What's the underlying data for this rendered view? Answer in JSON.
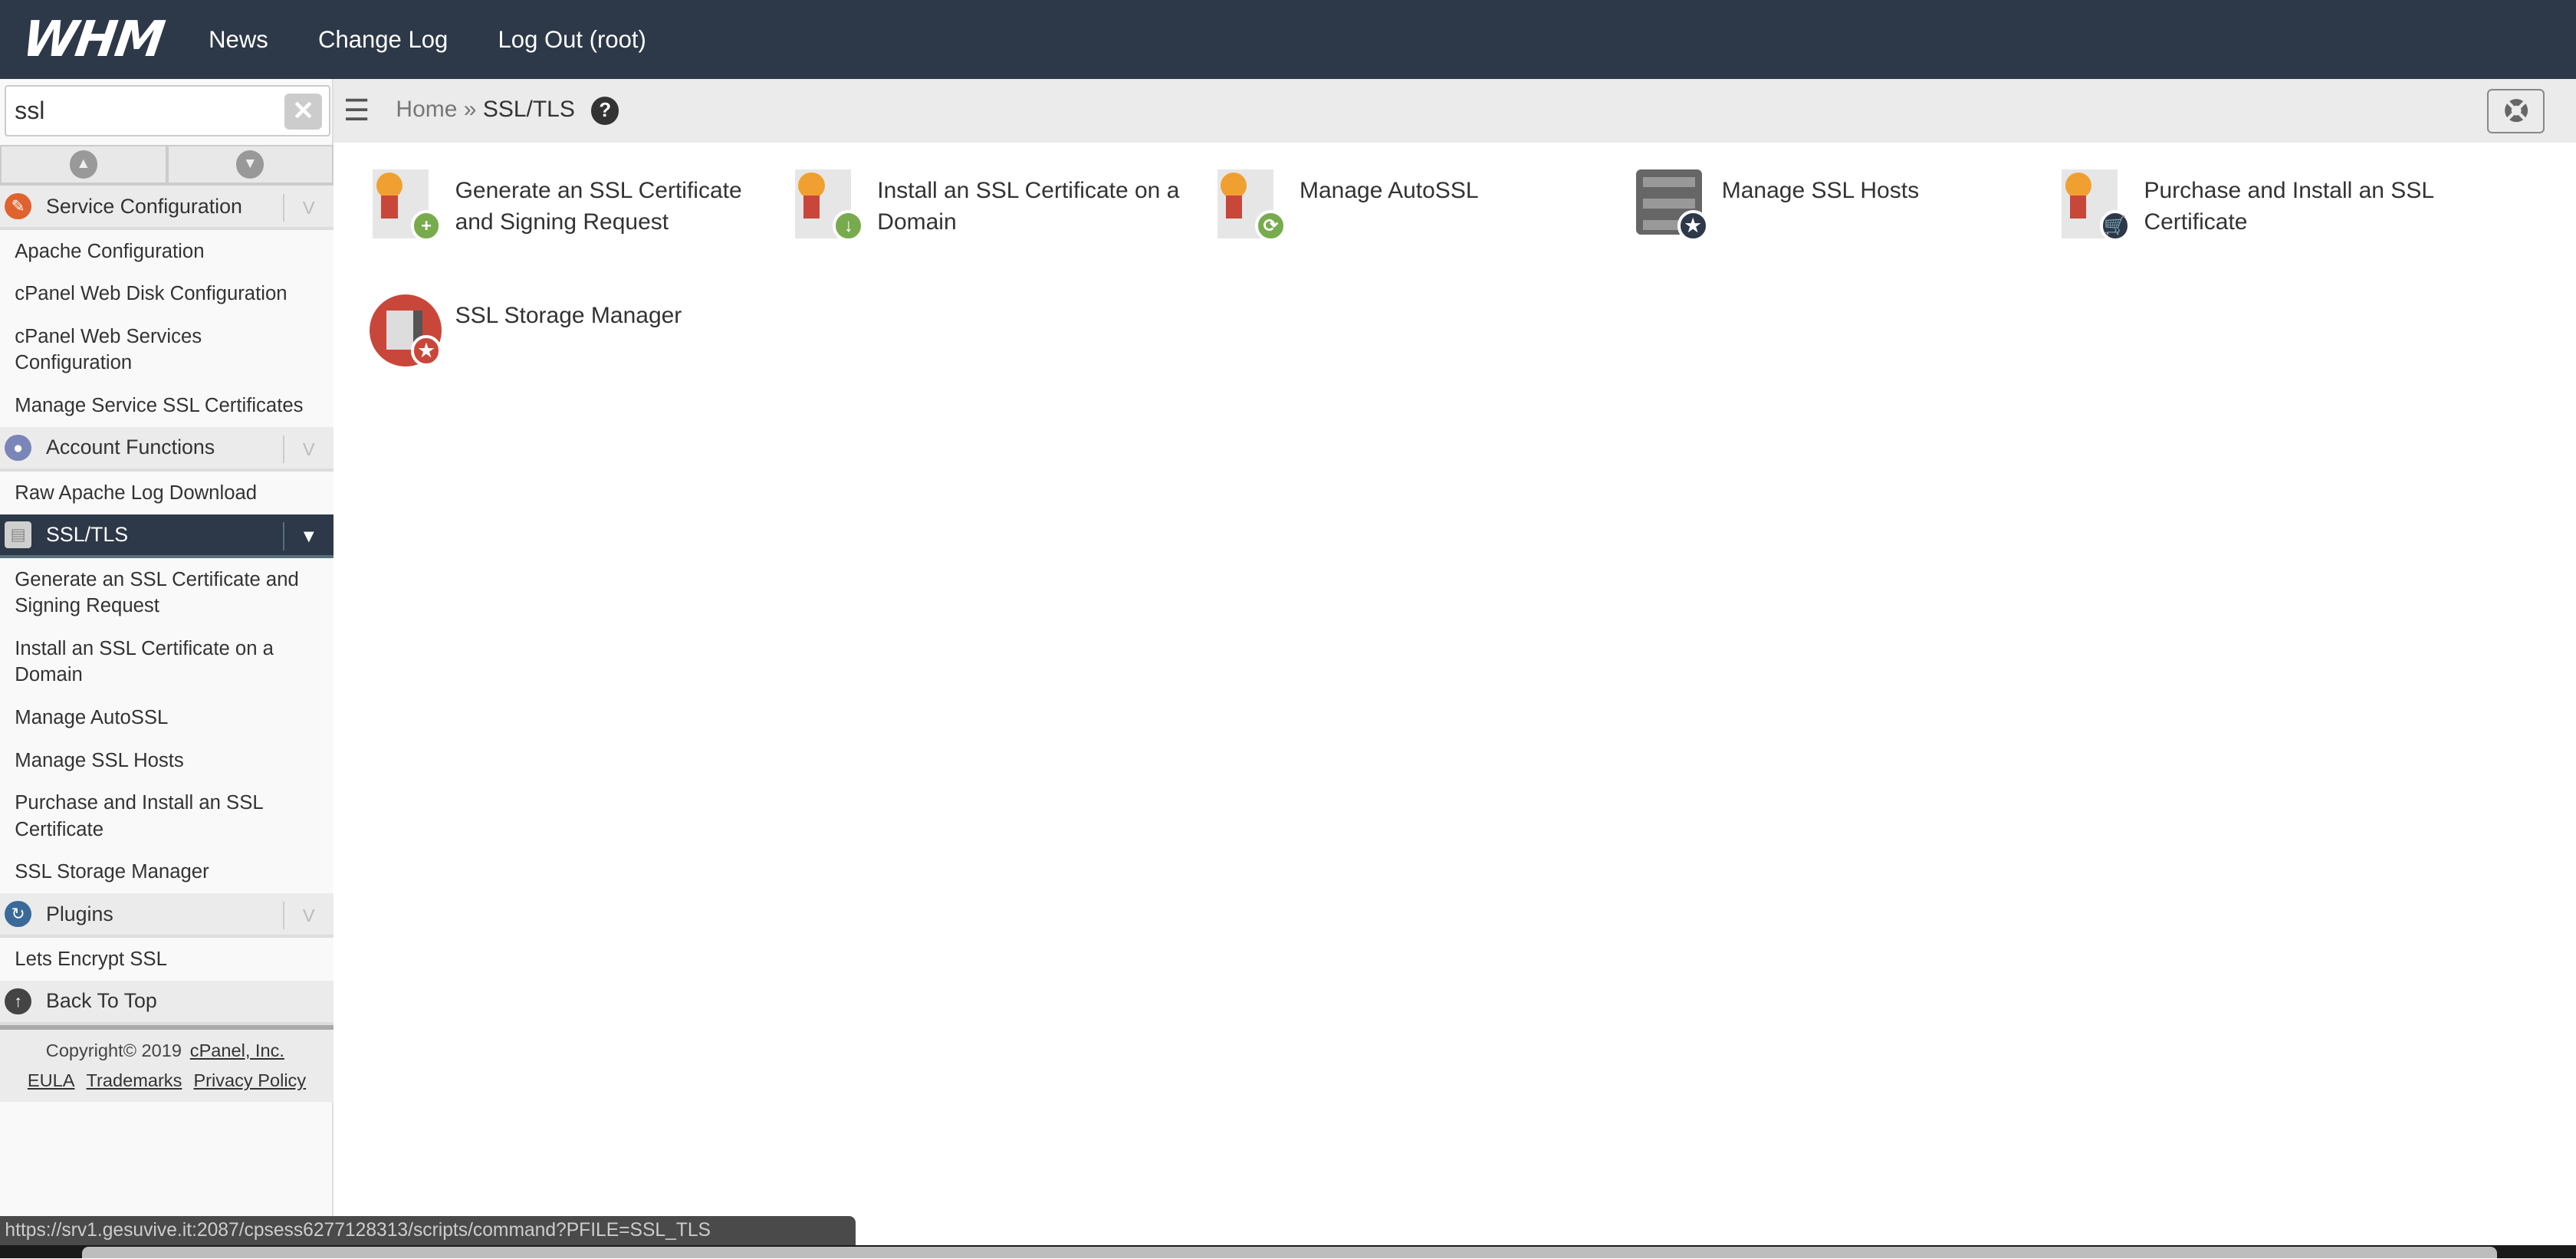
{
  "topbar": {
    "logo": "WHM",
    "nav": [
      "News",
      "Change Log",
      "Log Out (root)"
    ]
  },
  "search": {
    "value": "ssl",
    "clear_icon": "clear-icon"
  },
  "sidebar": {
    "groups": [
      {
        "title": "Service Configuration",
        "icon": "wrench-icon",
        "color": "#e0622f",
        "items": [
          "Apache Configuration",
          "cPanel Web Disk Configuration",
          "cPanel Web Services Configuration",
          "Manage Service SSL Certificates"
        ]
      },
      {
        "title": "Account Functions",
        "icon": "user-gear-icon",
        "color": "#7a86b8",
        "items": [
          "Raw Apache Log Download"
        ]
      },
      {
        "title": "SSL/TLS",
        "icon": "certificate-lock-icon",
        "color": "#cfcfcf",
        "active": true,
        "items": [
          "Generate an SSL Certificate and Signing Request",
          "Install an SSL Certificate on a Domain",
          "Manage AutoSSL",
          "Manage SSL Hosts",
          "Purchase and Install an SSL Certificate",
          "SSL Storage Manager"
        ]
      },
      {
        "title": "Plugins",
        "icon": "plug-icon",
        "color": "#3a6a9a",
        "items": [
          "Lets Encrypt SSL"
        ]
      }
    ],
    "back_to_top": "Back To Top",
    "footer": {
      "copyright": "Copyright© 2019",
      "company": "cPanel, Inc.",
      "links": [
        "EULA",
        "Trademarks",
        "Privacy Policy"
      ]
    }
  },
  "breadcrumb": {
    "home": "Home",
    "sep": "»",
    "current": "SSL/TLS"
  },
  "tiles": [
    {
      "label": "Generate an SSL Certificate and Signing Request",
      "badge": "plus",
      "badge_color": "#77ab4d"
    },
    {
      "label": "Install an SSL Certificate on a Domain",
      "badge": "download",
      "badge_color": "#77ab4d"
    },
    {
      "label": "Manage AutoSSL",
      "badge": "refresh",
      "badge_color": "#77ab4d"
    },
    {
      "label": "Manage SSL Hosts",
      "badge": "server",
      "badge_color": "#2d3848"
    },
    {
      "label": "Purchase and Install an SSL Certificate",
      "badge": "cart",
      "badge_color": "#2d3848"
    },
    {
      "label": "SSL Storage Manager",
      "badge": "storage",
      "badge_color": "#c9473a"
    }
  ],
  "status_url": "https://srv1.gesuvive.it:2087/cpsess6277128313/scripts/command?PFILE=SSL_TLS"
}
